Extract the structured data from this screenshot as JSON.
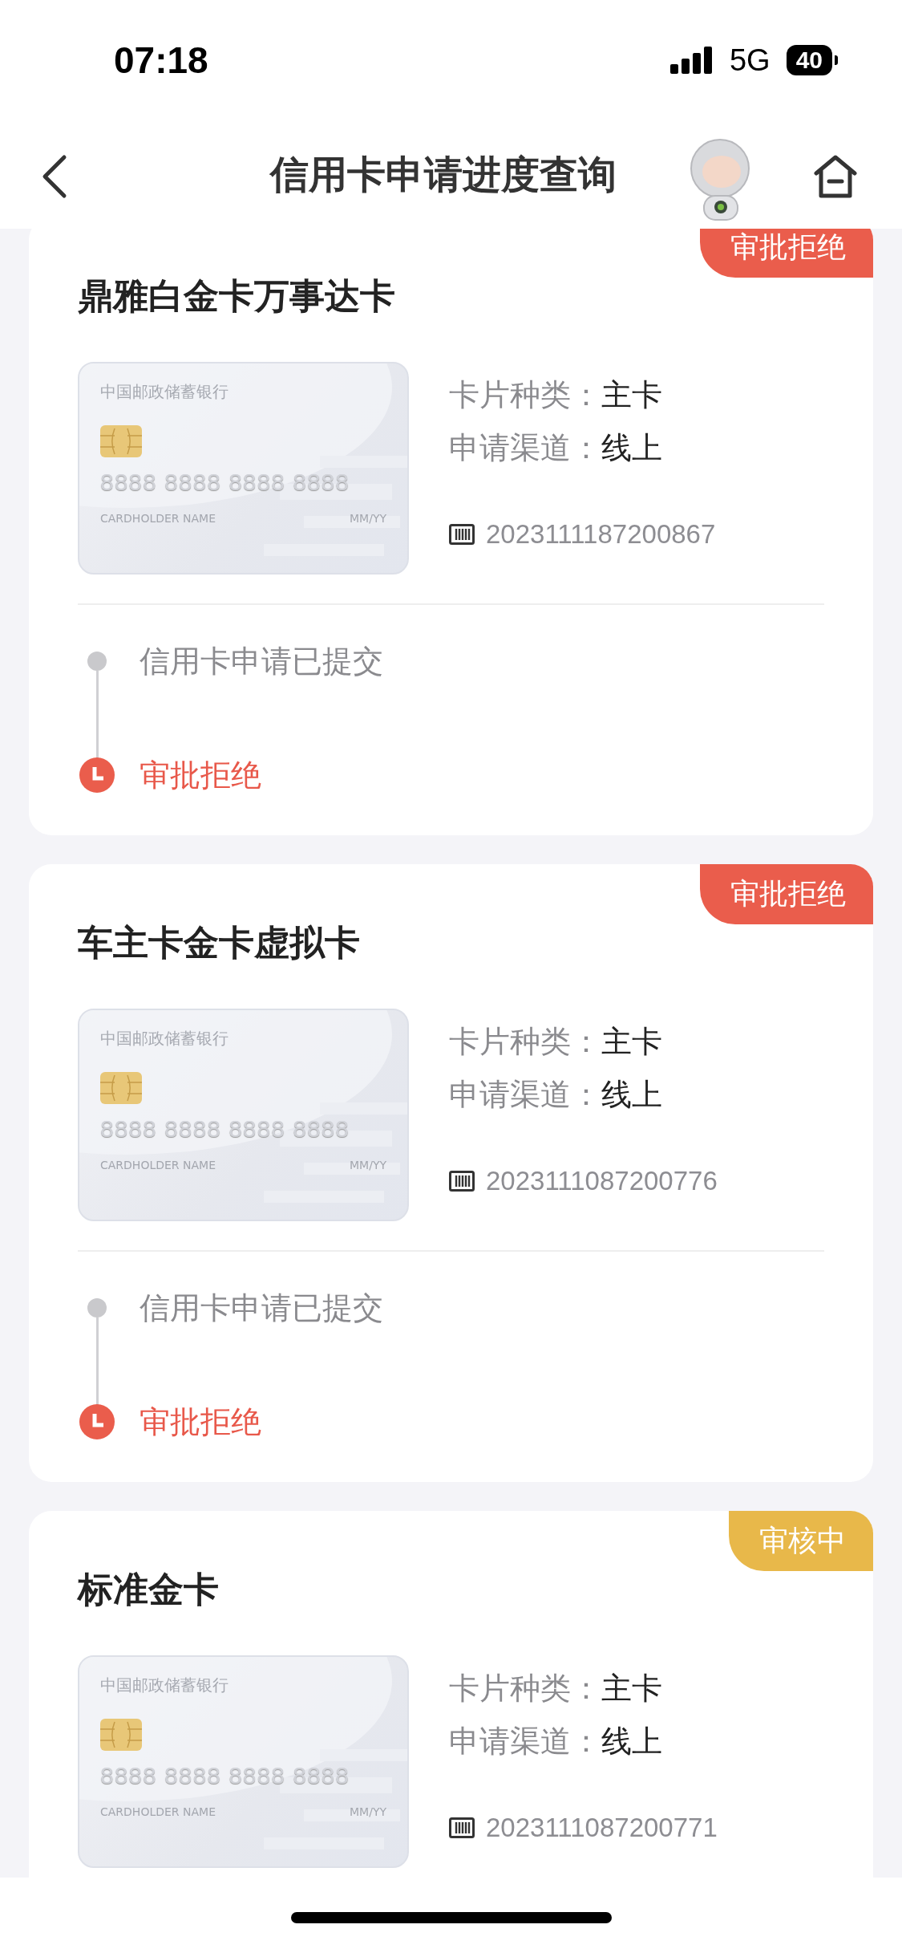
{
  "status_bar": {
    "time": "07:18",
    "network": "5G",
    "battery": "40"
  },
  "nav": {
    "title": "信用卡申请进度查询"
  },
  "applications": [
    {
      "name": "鼎雅白金卡万事达卡",
      "badge": {
        "text": "审批拒绝",
        "kind": "rejected"
      },
      "card_face": {
        "bank": "中国邮政储蓄银行",
        "number": "8888 8888 8888 8888",
        "holder": "CARDHOLDER NAME",
        "expiry": "MM/YY"
      },
      "info": [
        {
          "label": "卡片种类：",
          "value": "主卡"
        },
        {
          "label": "申请渠道：",
          "value": "线上"
        }
      ],
      "serial": "2023111187200867",
      "steps": [
        {
          "text": "信用卡申请已提交",
          "kind": "done"
        },
        {
          "text": "审批拒绝",
          "kind": "rejected"
        }
      ]
    },
    {
      "name": "车主卡金卡虚拟卡",
      "badge": {
        "text": "审批拒绝",
        "kind": "rejected"
      },
      "card_face": {
        "bank": "中国邮政储蓄银行",
        "number": "8888 8888 8888 8888",
        "holder": "CARDHOLDER NAME",
        "expiry": "MM/YY"
      },
      "info": [
        {
          "label": "卡片种类：",
          "value": "主卡"
        },
        {
          "label": "申请渠道：",
          "value": "线上"
        }
      ],
      "serial": "2023111087200776",
      "steps": [
        {
          "text": "信用卡申请已提交",
          "kind": "done"
        },
        {
          "text": "审批拒绝",
          "kind": "rejected"
        }
      ]
    },
    {
      "name": "标准金卡",
      "badge": {
        "text": "审核中",
        "kind": "reviewing"
      },
      "card_face": {
        "bank": "中国邮政储蓄银行",
        "number": "8888 8888 8888 8888",
        "holder": "CARDHOLDER NAME",
        "expiry": "MM/YY"
      },
      "info": [
        {
          "label": "卡片种类：",
          "value": "主卡"
        },
        {
          "label": "申请渠道：",
          "value": "线上"
        }
      ],
      "serial": "2023111087200771"
    }
  ]
}
